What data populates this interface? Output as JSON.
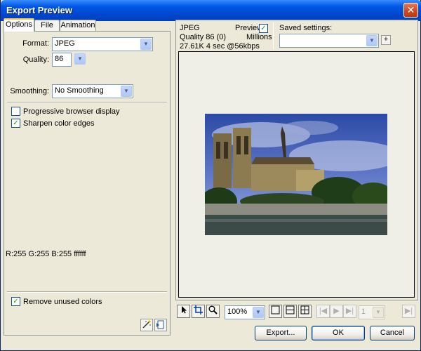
{
  "window": {
    "title": "Export Preview",
    "close_glyph": "✕"
  },
  "tabs": [
    {
      "label": "Options"
    },
    {
      "label": "File"
    },
    {
      "label": "Animation"
    }
  ],
  "options": {
    "format_label": "Format:",
    "format_value": "JPEG",
    "quality_label": "Quality:",
    "quality_value": "86",
    "smoothing_label": "Smoothing:",
    "smoothing_value": "No Smoothing",
    "progressive_label": "Progressive browser display",
    "progressive_checked": false,
    "sharpen_label": "Sharpen color edges",
    "sharpen_checked": true,
    "color_readout": "R:255 G:255 B:255 ffffff",
    "remove_unused_label": "Remove unused colors",
    "remove_unused_checked": true
  },
  "preview_info": {
    "format": "JPEG",
    "quality_line": "Quality 86 (0)",
    "size_line": "27.61K  4 sec @56kbps",
    "preview_label": "Preview",
    "preview_checked": true,
    "colors": "Millions",
    "saved_settings_label": "Saved settings:",
    "saved_settings_value": "",
    "add_glyph": "+"
  },
  "toolbar": {
    "zoom_value": "100%",
    "frame_value": "1"
  },
  "buttons": {
    "export": "Export...",
    "ok": "OK",
    "cancel": "Cancel"
  },
  "colors": {
    "titlebar": "#0058e6",
    "face": "#ece9d8",
    "check": "#21a121"
  }
}
